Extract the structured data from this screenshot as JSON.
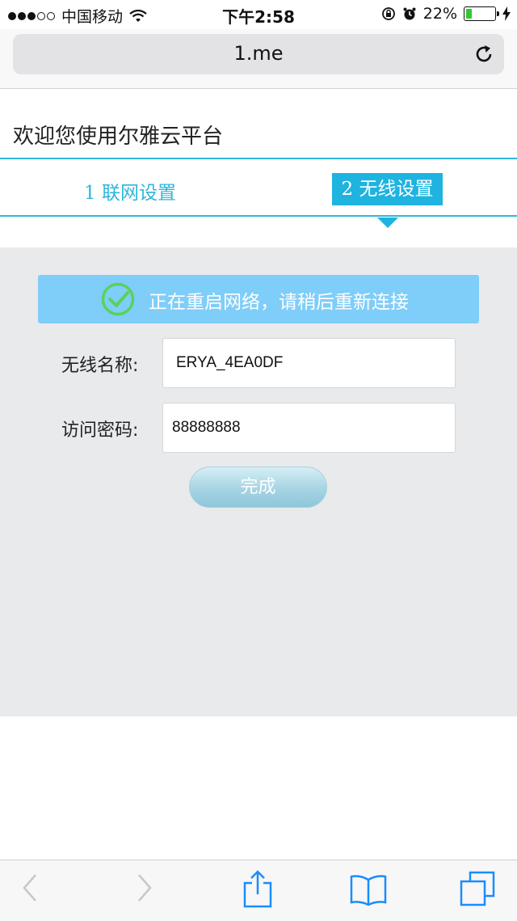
{
  "status_bar": {
    "carrier": "中国移动",
    "time": "下午2:58",
    "battery_percent": "22%",
    "battery_level": 0.22,
    "signal_dots_filled": 3,
    "signal_dots_total": 5
  },
  "browser": {
    "url": "1.me"
  },
  "page": {
    "welcome": "欢迎您使用尔雅云平台",
    "steps": [
      {
        "label": "1 联网设置",
        "active": false
      },
      {
        "label": "2  无线设置",
        "active": true
      }
    ],
    "notice": "正在重启网络，请稍后重新连接",
    "form": {
      "ssid_label": "无线名称:",
      "ssid_value": "ERYA_4EA0DF",
      "password_label": "访问密码:",
      "password_value": "88888888",
      "submit_label": "完成"
    }
  },
  "colors": {
    "accent": "#1fb3e0",
    "notice_bg": "#7fcdf9",
    "panel_bg": "#e9eaec",
    "check_green": "#5ad25a",
    "ios_blue": "#1a8cff"
  },
  "icons": [
    "wifi-icon",
    "lock-rotation-icon",
    "alarm-icon",
    "battery-icon",
    "charging-icon",
    "reload-icon",
    "check-circle-icon",
    "back-icon",
    "forward-icon",
    "share-icon",
    "bookmarks-icon",
    "tabs-icon"
  ]
}
